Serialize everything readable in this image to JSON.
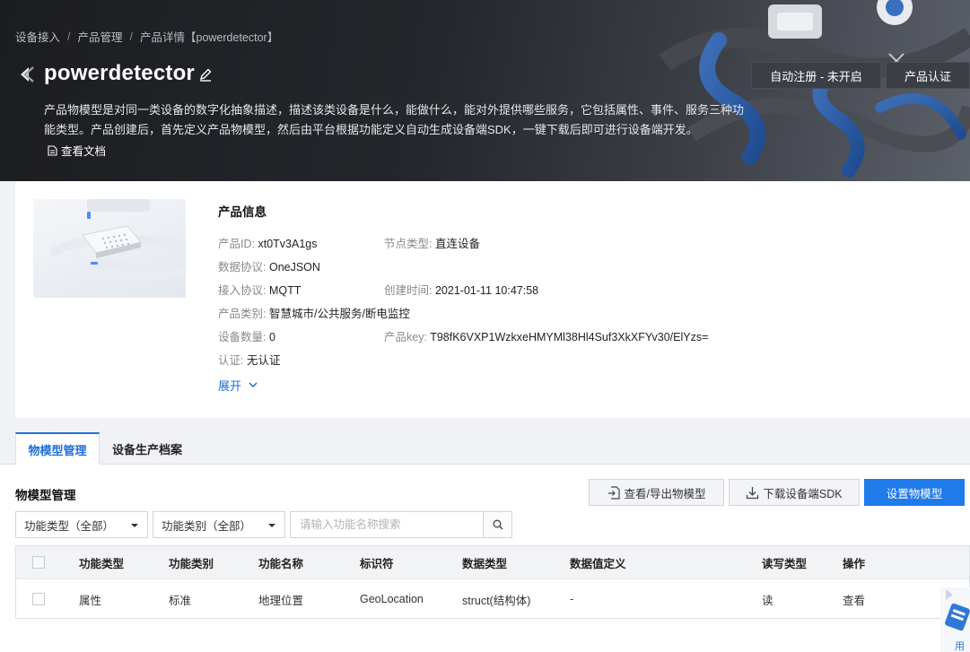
{
  "breadcrumb": [
    "设备接入",
    "产品管理",
    "产品详情【powerdetector】"
  ],
  "product": {
    "title": "powerdetector",
    "description": "产品物模型是对同一类设备的数字化抽象描述，描述该类设备是什么，能做什么，能对外提供哪些服务，它包括属性、事件、服务三种功能类型。产品创建后，首先定义产品物模型，然后由平台根据功能定义自动生成设备端SDK，一键下载后即可进行设备端开发。",
    "doc_link": "查看文档"
  },
  "header_buttons": {
    "auto_register": "自动注册 - 未开启",
    "certify": "产品认证"
  },
  "info": {
    "title": "产品信息",
    "product_id_label": "产品ID:",
    "product_id": "xt0Tv3A1gs",
    "node_type_label": "节点类型:",
    "node_type": "直连设备",
    "data_protocol_label": "数据协议:",
    "data_protocol": "OneJSON",
    "access_protocol_label": "接入协议:",
    "access_protocol": "MQTT",
    "created_label": "创建时间:",
    "created": "2021-01-11 10:47:58",
    "category_label": "产品类别:",
    "category": "智慧城市/公共服务/断电监控",
    "device_count_label": "设备数量:",
    "device_count": "0",
    "product_key_label": "产品key:",
    "product_key": "T98fK6VXP1WzkxeHMYMl38Hl4Suf3XkXFYv30/ElYzs=",
    "cert_label": "认证:",
    "cert": "无认证",
    "expand": "展开"
  },
  "tabs": [
    {
      "label": "物模型管理",
      "active": true
    },
    {
      "label": "设备生产档案",
      "active": false
    }
  ],
  "model": {
    "title": "物模型管理",
    "btn_view": "查看/导出物模型",
    "btn_sdk": "下载设备端SDK",
    "btn_set": "设置物模型",
    "filter_type": "功能类型（全部）",
    "filter_category": "功能类别（全部）",
    "search_placeholder": "请输入功能名称搜索"
  },
  "table": {
    "headers": [
      "功能类型",
      "功能类别",
      "功能名称",
      "标识符",
      "数据类型",
      "数据值定义",
      "读写类型",
      "操作"
    ],
    "rows": [
      [
        "属性",
        "标准",
        "地理位置",
        "GeoLocation",
        "struct(结构体)",
        "-",
        "读",
        "查看"
      ]
    ]
  },
  "colors": {
    "accent": "#1f7bea",
    "link": "#1f6fd8",
    "banner": "#25272c"
  },
  "float_widget_text": "用"
}
